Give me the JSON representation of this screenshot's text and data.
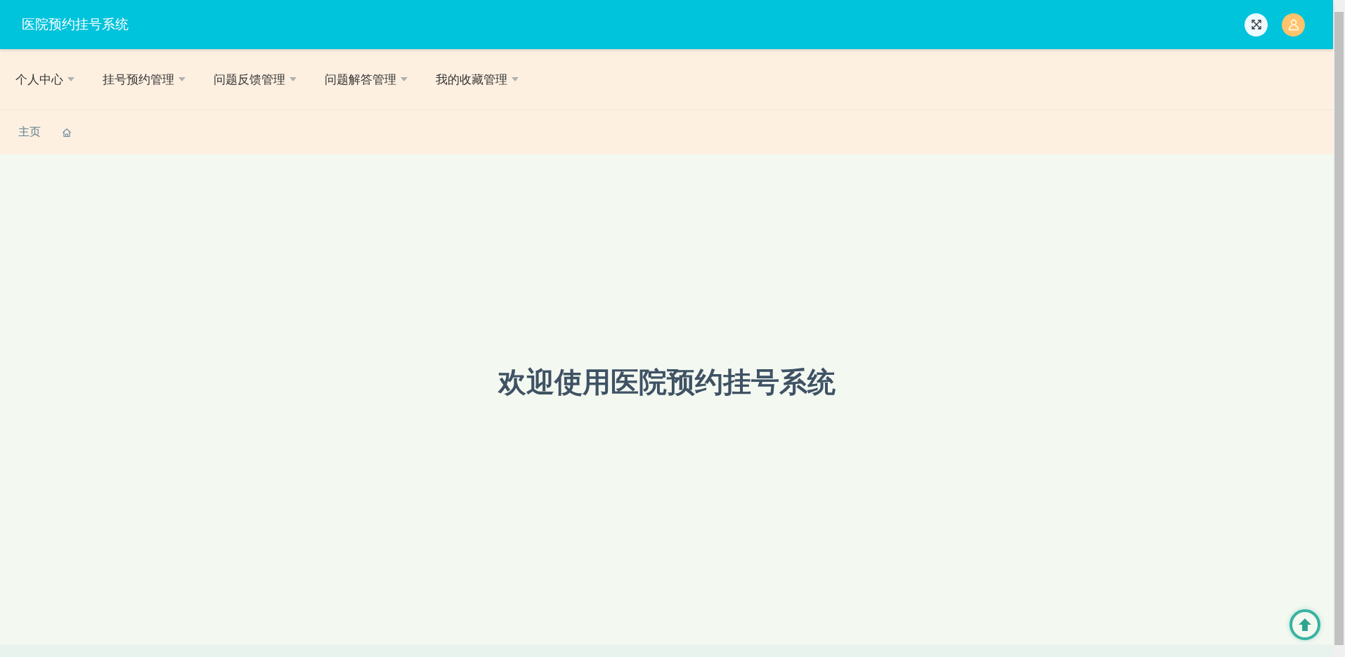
{
  "header": {
    "title": "医院预约挂号系统"
  },
  "nav": [
    {
      "label": "个人中心"
    },
    {
      "label": "挂号预约管理"
    },
    {
      "label": "问题反馈管理"
    },
    {
      "label": "问题解答管理"
    },
    {
      "label": "我的收藏管理"
    }
  ],
  "breadcrumb": {
    "label": "主页"
  },
  "welcome": "欢迎使用医院预约挂号系统"
}
